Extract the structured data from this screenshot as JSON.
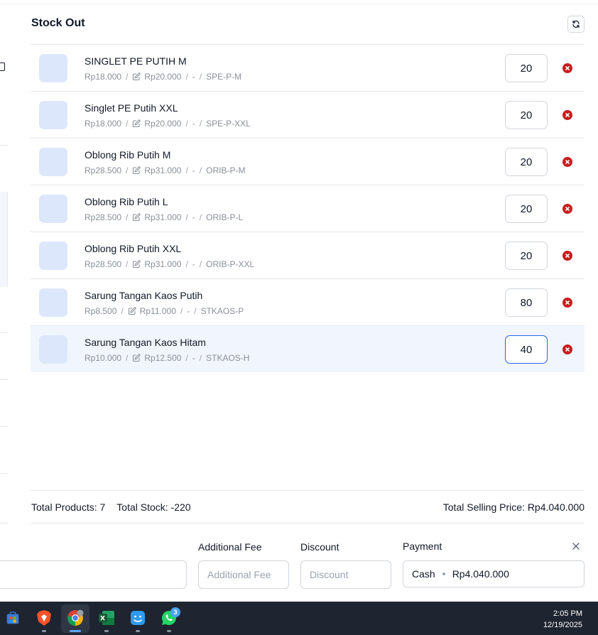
{
  "header": {
    "title": "Stock Out",
    "refresh_icon": "refresh-icon"
  },
  "products": [
    {
      "name": "SINGLET PE PUTIH M",
      "cost": "Rp18.000",
      "price": "Rp20.000",
      "variant": "-",
      "sku": "SPE-P-M",
      "qty": "20"
    },
    {
      "name": "Singlet PE Putih XXL",
      "cost": "Rp18.000",
      "price": "Rp20.000",
      "variant": "-",
      "sku": "SPE-P-XXL",
      "qty": "20"
    },
    {
      "name": "Oblong Rib Putih M",
      "cost": "Rp28.500",
      "price": "Rp31.000",
      "variant": "-",
      "sku": "ORIB-P-M",
      "qty": "20"
    },
    {
      "name": "Oblong Rib Putih L",
      "cost": "Rp28.500",
      "price": "Rp31.000",
      "variant": "-",
      "sku": "ORIB-P-L",
      "qty": "20"
    },
    {
      "name": "Oblong Rib Putih XXL",
      "cost": "Rp28.500",
      "price": "Rp31.000",
      "variant": "-",
      "sku": "ORIB-P-XXL",
      "qty": "20"
    },
    {
      "name": "Sarung Tangan Kaos Putih",
      "cost": "Rp8.500",
      "price": "Rp11.000",
      "variant": "-",
      "sku": "STKAOS-P",
      "qty": "80"
    },
    {
      "name": "Sarung Tangan Kaos Hitam",
      "cost": "Rp10.000",
      "price": "Rp12.500",
      "variant": "-",
      "sku": "STKAOS-H",
      "qty": "40"
    }
  ],
  "separator": "/",
  "summary": {
    "total_products": "Total Products: 7",
    "total_stock": "Total Stock: -220",
    "total_selling_price": "Total Selling Price: Rp4.040.000"
  },
  "fields": {
    "additional_fee_label": "Additional Fee",
    "additional_fee_placeholder": "Additional Fee",
    "discount_label": "Discount",
    "discount_placeholder": "Discount",
    "payment_label": "Payment",
    "payment_method": "Cash",
    "payment_amount": "Rp4.040.000"
  },
  "taskbar": {
    "apps": [
      "windows-store-icon",
      "brave-browser-icon",
      "chrome-browser-icon",
      "excel-icon",
      "finder-icon",
      "whatsapp-icon"
    ],
    "whatsapp_badge": "3",
    "time": "2:05 PM",
    "date": "12/19/2025"
  },
  "colors": {
    "accent": "#2563eb",
    "danger": "#c81e1e",
    "thumb": "#dde7fb",
    "active_row": "#f1f5fd"
  }
}
